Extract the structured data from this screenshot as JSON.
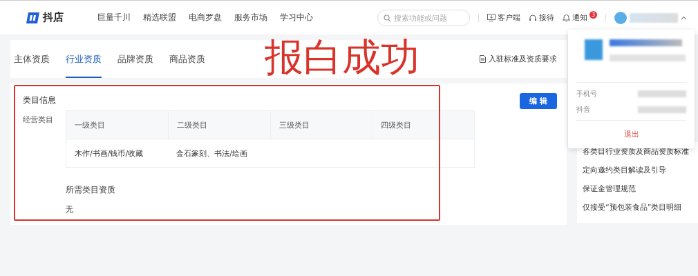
{
  "header": {
    "logo": "抖店",
    "nav": [
      "巨量千川",
      "精选联盟",
      "电商罗盘",
      "服务市场",
      "学习中心"
    ],
    "search": {
      "placeholder": "搜索功能或问题"
    },
    "tools": [
      {
        "kind": "client",
        "label": "客户端"
      },
      {
        "kind": "service",
        "label": "接待"
      },
      {
        "kind": "bell",
        "label": "通知",
        "badge": "3"
      }
    ]
  },
  "tabs": [
    {
      "label": "主体资质",
      "selected": false
    },
    {
      "label": "行业资质",
      "selected": true
    },
    {
      "label": "品牌资质",
      "selected": false
    },
    {
      "label": "商品资质",
      "selected": false
    }
  ],
  "standards_link": "入驻标准及资质要求",
  "annotation": {
    "text": "报白成功"
  },
  "category_info": {
    "title": "类目信息",
    "edit_button": "编 辑",
    "field_label": "经营类目",
    "table": {
      "columns": [
        "一级类目",
        "二级类目",
        "三级类目",
        "四级类目"
      ],
      "rows": [
        [
          "木作/书画/钱币/收藏",
          "金石篆刻、书法/绘画",
          "",
          ""
        ]
      ]
    },
    "required_title": "所需类目资质",
    "required_value": "无"
  },
  "user_menu": {
    "rows": [
      {
        "label": "手机号"
      },
      {
        "label": "抖音"
      }
    ],
    "logout": "退出"
  },
  "help_links": [
    "各类目行业资质及商品资质标准",
    "定向邀约类目解读及引导",
    "保证金管理规范",
    "仅接受“预包装食品”类目明细"
  ]
}
